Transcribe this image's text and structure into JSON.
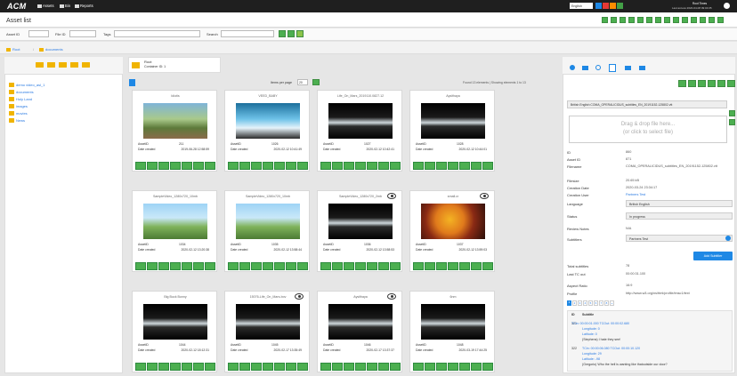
{
  "app": {
    "logo": "ACM",
    "nav": [
      "Assets",
      "Bin",
      "Reports"
    ],
    "language": "English",
    "user_info": "Last access 2020-04-08 09:04:05",
    "user_name": "Root Times"
  },
  "page": {
    "title": "Asset list"
  },
  "filters": {
    "asset_id_label": "Asset ID",
    "file_id_label": "File ID",
    "tags_label": "Tags",
    "search_label": "Search"
  },
  "breadcrumb": {
    "root": "Root",
    "current": "documents"
  },
  "folder_panel": {
    "name": "Root",
    "count": "Container ID: 1"
  },
  "tree": [
    "demo video_asl_1",
    "documents",
    "Holy Land",
    "images",
    "movies",
    "News"
  ],
  "grid": {
    "items_per_page_label": "Items per page",
    "items_per_page": "20",
    "found": "Found 13 elements | Showing elements 1 to 13",
    "cards": [
      {
        "title": "Idiotis",
        "asset_id": "211",
        "date": "2019-06-28 12:58:59",
        "thumb": "forest",
        "eye": false
      },
      {
        "title": "VEED_BABY",
        "asset_id": "1026",
        "date": "2020-02-12 10:41:49",
        "thumb": "veed",
        "eye": false
      },
      {
        "title": "Life_On_Mars_2019110.0827.12",
        "asset_id": "1027",
        "date": "2020-02-12 10:42:41",
        "thumb": "dark",
        "eye": false
      },
      {
        "title": "Aysithaya",
        "asset_id": "1028",
        "date": "2020-02-12 10:44:01",
        "thumb": "dark",
        "eye": false
      },
      {
        "title": "SampleVideo_1280x720_10mb",
        "asset_id": "1034",
        "date": "2020-02-12 13:20:38",
        "thumb": "bunny",
        "eye": false
      },
      {
        "title": "SampleVideo_1280x720_10mb",
        "asset_id": "1035",
        "date": "2020-02-12 13:58:44",
        "thumb": "bunny",
        "eye": false
      },
      {
        "title": "SampleVideo_1280x720_2mb",
        "asset_id": "1036",
        "date": "2020-02-12 13:58:53",
        "thumb": "dark",
        "eye": true
      },
      {
        "title": "small.cr",
        "asset_id": "1037",
        "date": "2020-02-12 13:59:03",
        "thumb": "fruit",
        "eye": true
      },
      {
        "title": "Big Buck Bunny",
        "asset_id": "1044",
        "date": "2020-02-12 18:12:31",
        "thumb": "dark",
        "eye": false
      },
      {
        "title": "15076-Life_On_Mars-bov",
        "asset_id": "1045",
        "date": "2020-02-17 13:35:49",
        "thumb": "dark",
        "eye": true
      },
      {
        "title": "Aysithaya",
        "asset_id": "1046",
        "date": "2020-02-17 13:37:37",
        "thumb": "dark",
        "eye": true
      },
      {
        "title": "6nm",
        "asset_id": "1048",
        "date": "2020-03-19 17:44:25",
        "thumb": "dark",
        "eye": false
      }
    ],
    "asset_id_label": "AssetID",
    "date_label": "Date created"
  },
  "detail": {
    "file_select": "British English COMA_OPERALICIDUS_subtitles_EN_20191152-125802.vtt",
    "dropzone_line1": "Drag & drop file here...",
    "dropzone_line2": "(or click to select file)",
    "fields": [
      {
        "label": "ID",
        "value": "860"
      },
      {
        "label": "Asset ID",
        "value": "871"
      },
      {
        "label": "Filename",
        "value": "COMA_OPERALICIDUS_subtitles_EN_20191152-125802.vtt"
      },
      {
        "label": "Filesize",
        "value": "20.65 kB"
      },
      {
        "label": "Creation Date",
        "value": "2020-03-24 23:34:17"
      },
      {
        "label": "Creation User",
        "value": "Partners Test"
      }
    ],
    "language_label": "Language",
    "language_value": "British English",
    "status_label": "Status",
    "status_value": "In progress",
    "review_label": "Review Notes",
    "review_value": "N/A",
    "subtitlers_label": "Subtitlers",
    "subtitlers_value": "Partners Test",
    "add_subtitler": "Add Subtitler",
    "total_label": "Total subtitles",
    "total_value": "78",
    "tc_label": "Last TC out",
    "tc_value": "00:00:31.100",
    "aspect_label": "Aspect Ratio",
    "aspect_value": "16:9",
    "profile_label": "Profile",
    "profile_value": "http://www.w3.org/ns/ttml/profile/imsc1/text",
    "pages": [
      "1",
      "2",
      "3",
      "4",
      "5",
      "6",
      "7",
      "8",
      "»"
    ],
    "table_head_id": "ID",
    "table_head_sub": "Subtitle",
    "subtitles": [
      {
        "id": "321",
        "tc": "TCin: 00:00:01.000 TCOut: 00:00:02.680",
        "longitude": "Longitude: 0",
        "latitude": "Latitude: 0",
        "text": "(Stephens) I hate they see!"
      },
      {
        "id": "322",
        "tc": "TCin: 00:00:06.080 TCOut: 00:00:10.120",
        "longitude": "Longitude: 29",
        "latitude": "Latitude: -98",
        "text": "(Gregorio) Who the hell is wanting like thatoutside our door?"
      }
    ]
  },
  "colors": {
    "topbar": "#1f1f1f",
    "accent": "#4caf50",
    "link": "#2a7ae2",
    "folder": "#f0b400",
    "add": "#1e88e5"
  }
}
